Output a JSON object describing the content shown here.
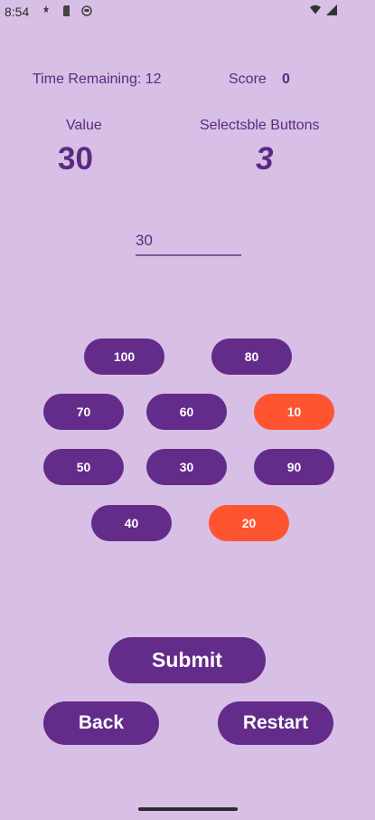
{
  "status_bar": {
    "time": "8:54",
    "icons": [
      "android-debug-icon",
      "sd-card-icon",
      "record-icon",
      "wifi-icon",
      "signal-icon"
    ]
  },
  "game": {
    "time_remaining_label": "Time Remaining: 12",
    "score_label": "Score",
    "score_value": "0",
    "value_label": "Value",
    "value_number": "30",
    "selectable_label": "Selectsble Buttons",
    "selectable_number": "3",
    "input_value": "30"
  },
  "buttons": [
    {
      "label": "100",
      "selected": false
    },
    {
      "label": "80",
      "selected": false
    },
    {
      "label": "70",
      "selected": false
    },
    {
      "label": "60",
      "selected": false
    },
    {
      "label": "10",
      "selected": true
    },
    {
      "label": "50",
      "selected": false
    },
    {
      "label": "30",
      "selected": false
    },
    {
      "label": "90",
      "selected": false
    },
    {
      "label": "40",
      "selected": false
    },
    {
      "label": "20",
      "selected": true
    }
  ],
  "actions": {
    "submit_label": "Submit",
    "back_label": "Back",
    "restart_label": "Restart"
  },
  "colors": {
    "background": "#d8bfe5",
    "button_primary": "#632b8a",
    "button_selected": "#ff5430",
    "text_purple": "#5a2a83"
  }
}
